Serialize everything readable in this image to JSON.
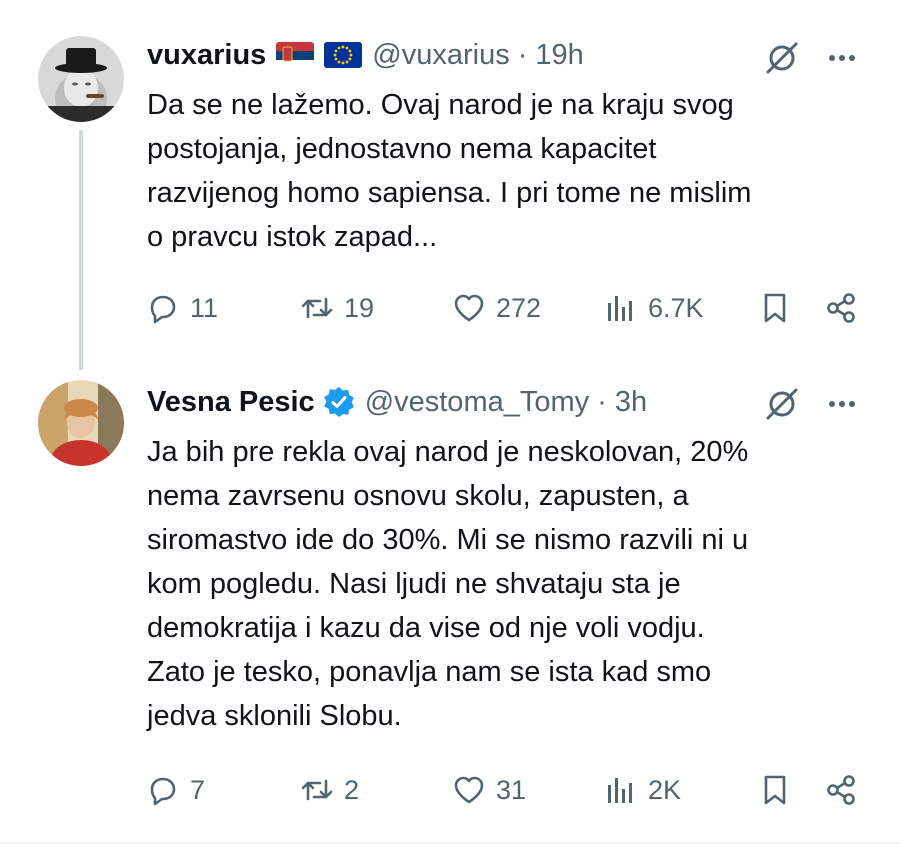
{
  "tweets": [
    {
      "name": "vuxarius",
      "badges": [
        "serbia-flag-icon",
        "eu-flag-icon"
      ],
      "handle": "@vuxarius",
      "dot": "·",
      "time": "19h",
      "text": "Da se ne lažemo. Ovaj narod je na kraju svog\npostojanja, jednostavno nema kapacitet\nrazvijenog homo sapiensa. I pri tome ne mislim\no pravcu istok zapad...",
      "replies": "11",
      "reposts": "19",
      "likes": "272",
      "views": "6.7K"
    },
    {
      "name": "Vesna Pesic",
      "badges": [
        "verified-icon"
      ],
      "handle": "@vestoma_Tomy",
      "dot": "·",
      "time": "3h",
      "text": "Ja bih pre rekla ovaj narod je neskolovan, 20%\nnema zavrsenu osnovu skolu, zapusten, a\nsiromastvo ide do 30%. Mi se nismo razvili  ni u\nkom pogledu. Nasi ljudi ne shvataju sta je\ndemokratija i kazu da vise od nje voli vodju.\nZato je  tesko, ponavlja nam se ista kad smo\njedva sklonili Slobu.",
      "replies": "7",
      "reposts": "2",
      "likes": "31",
      "views": "2K"
    }
  ],
  "colors": {
    "text": "#0f1419",
    "muted": "#536471",
    "verified": "#1d9bf0",
    "thread_line": "#cfd9de"
  }
}
